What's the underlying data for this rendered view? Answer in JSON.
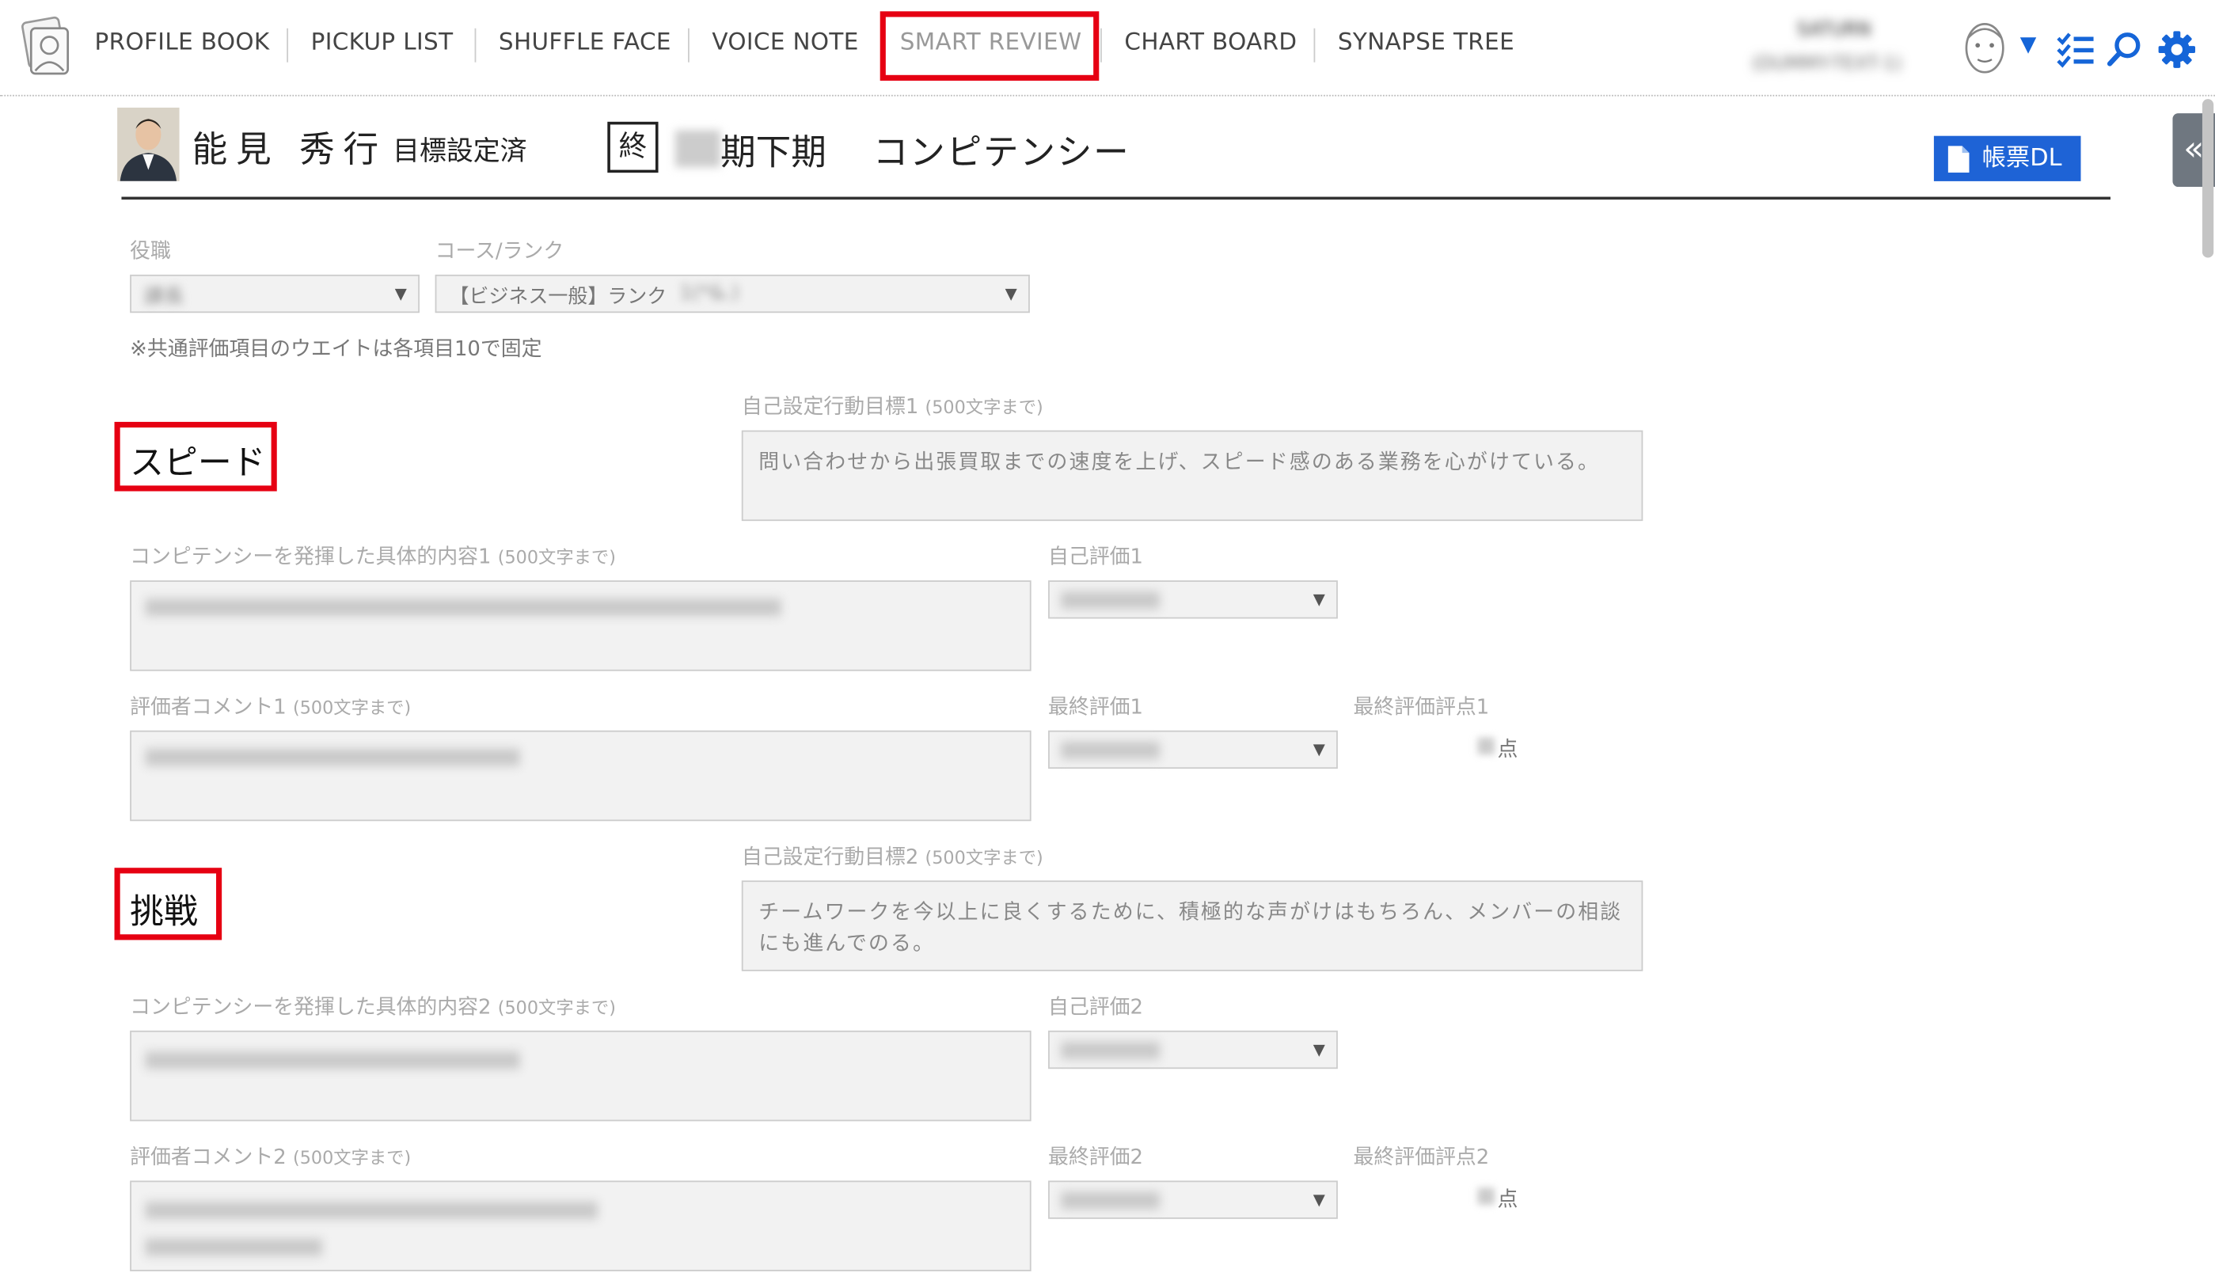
{
  "nav": {
    "items": [
      {
        "label": "PROFILE BOOK"
      },
      {
        "label": "PICKUP LIST"
      },
      {
        "label": "SHUFFLE FACE"
      },
      {
        "label": "VOICE NOTE"
      },
      {
        "label": "SMART REVIEW"
      },
      {
        "label": "CHART BOARD"
      },
      {
        "label": "SYNAPSE TREE"
      }
    ],
    "active": "SMART REVIEW"
  },
  "user": {
    "line1": "SATURN",
    "line2": "(DUMMY-TEXT-1)"
  },
  "header": {
    "name": "能見 秀行",
    "status": "目標設定済",
    "end_badge": "終",
    "period_blur": "00",
    "period": "期下期",
    "title": "コンピテンシー",
    "download_label": "帳票DL",
    "side_toggle": "«"
  },
  "form": {
    "position_label": "役職",
    "position_value": "課長",
    "course_label": "コース/ランク",
    "course_value": "【ビジネス一般】ランク",
    "course_value_blur": "1(*&.)",
    "note": "※共通評価項目のウエイトは各項目10で固定"
  },
  "sections": [
    {
      "heading": "スピード",
      "goal_label": "自己設定行動目標1",
      "goal_limit": "(500文字まで)",
      "goal_text": "問い合わせから出張買取までの速度を上げ、スピード感のある業務を心がけている。",
      "detail_label": "コンピテンシーを発揮した具体的内容1",
      "detail_limit": "(500文字まで)",
      "self_eval_label": "自己評価1",
      "comment_label": "評価者コメント1",
      "comment_limit": "(500文字まで)",
      "final_label": "最終評価1",
      "final_points_label": "最終評価評点1",
      "points_unit": "点"
    },
    {
      "heading": "挑戦",
      "goal_label": "自己設定行動目標2",
      "goal_limit": "(500文字まで)",
      "goal_text": "チームワークを今以上に良くするために、積極的な声がけはもちろん、メンバーの相談にも進んでのる。",
      "detail_label": "コンピテンシーを発揮した具体的内容2",
      "detail_limit": "(500文字まで)",
      "self_eval_label": "自己評価2",
      "comment_label": "評価者コメント2",
      "comment_limit": "(500文字まで)",
      "final_label": "最終評価2",
      "final_points_label": "最終評価評点2",
      "points_unit": "点"
    }
  ],
  "colors": {
    "accent": "#1e63d6",
    "highlight": "#e60012",
    "header_line": "#333333"
  },
  "icons": [
    "logo-icon",
    "avatar-icon",
    "checklist-icon",
    "search-icon",
    "gear-icon",
    "document-icon",
    "collapse-icon"
  ]
}
